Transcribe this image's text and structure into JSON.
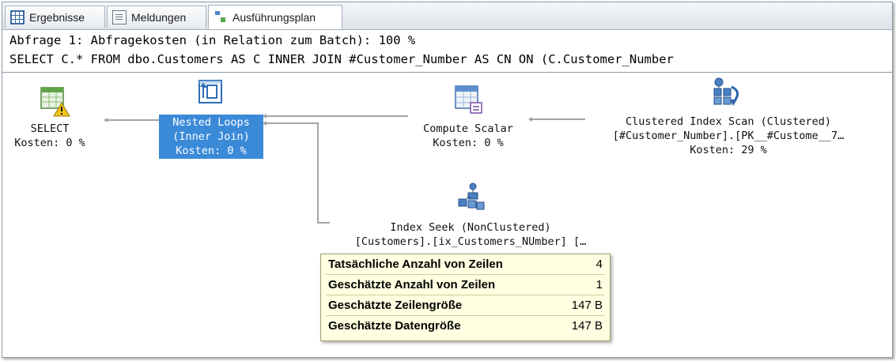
{
  "tabs": [
    {
      "label": "Ergebnisse",
      "icon": "results-grid-icon"
    },
    {
      "label": "Meldungen",
      "icon": "messages-icon"
    },
    {
      "label": "Ausführungsplan",
      "icon": "execution-plan-icon"
    }
  ],
  "query": {
    "line1": "Abfrage 1: Abfragekosten (in Relation zum Batch): 100 %",
    "line2": "SELECT C.* FROM dbo.Customers AS C INNER JOIN #Customer_Number AS CN ON (C.Customer_Number"
  },
  "operators": {
    "select": {
      "name": "SELECT",
      "cost": "Kosten: 0 %",
      "icon": "select-warning-icon"
    },
    "nested_loops": {
      "name1": "Nested Loops",
      "name2": "(Inner Join)",
      "cost": "Kosten: 0 %",
      "icon": "nested-loops-icon"
    },
    "compute_scalar": {
      "name": "Compute Scalar",
      "cost": "Kosten: 0 %",
      "icon": "compute-scalar-icon"
    },
    "clustered_scan": {
      "name1": "Clustered Index Scan (Clustered)",
      "name2": "[#Customer_Number].[PK__#Custome__7…",
      "cost": "Kosten: 29 %",
      "icon": "clustered-index-scan-icon"
    },
    "index_seek": {
      "name1": "Index Seek (NonClustered)",
      "name2": "[Customers].[ix_Customers_NUmber] […",
      "icon": "index-seek-icon"
    }
  },
  "tooltip": {
    "rows": [
      {
        "label": "Tatsächliche Anzahl von Zeilen",
        "value": "4"
      },
      {
        "label": "Geschätzte Anzahl von Zeilen",
        "value": "1"
      },
      {
        "label": "Geschätzte Zeilengröße",
        "value": "147 B"
      },
      {
        "label": "Geschätzte Datengröße",
        "value": "147 B"
      }
    ]
  },
  "colors": {
    "selection": "#3b8ad8",
    "tooltip_bg": "#ffffe1",
    "connector": "#a4a4a4"
  }
}
